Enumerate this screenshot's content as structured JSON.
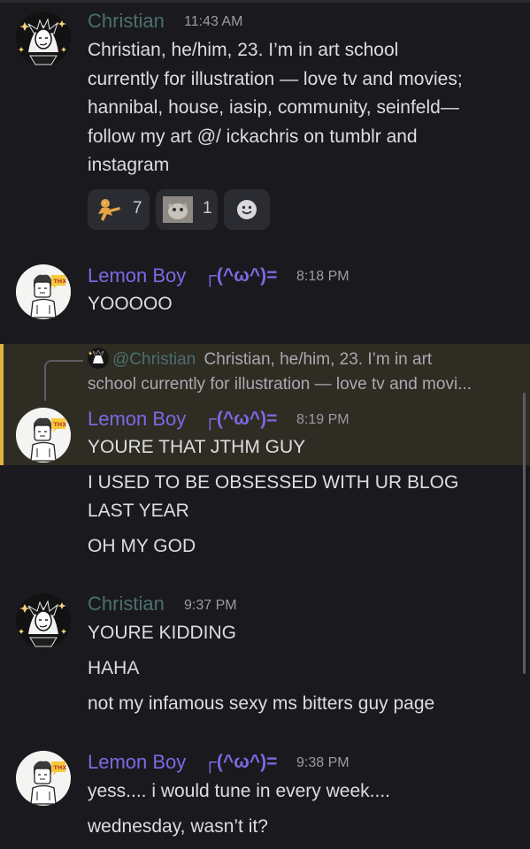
{
  "messages": [
    {
      "author": "Christian",
      "time": "11:43 AM",
      "lines": [
        "Christian, he/him, 23. I’m in art school",
        "currently for illustration — love tv and movies;",
        "hannibal, house, iasip, community, seinfeld—",
        "follow my art @/ ickachris on tumblr and",
        "instagram"
      ],
      "emoji": "🙂",
      "reactions": [
        {
          "icon": "gingerbread-dancer-emoji",
          "count": "7"
        },
        {
          "icon": "cat-face-photo-emoji",
          "count": "1"
        },
        {
          "icon": "add-reaction-icon",
          "count": ""
        }
      ]
    },
    {
      "author": "Lemon Boy",
      "tag": "┌(^ω^)=",
      "time": "8:18 PM",
      "lines": [
        "YOOOOO"
      ]
    },
    {
      "reply": {
        "mention": "@Christian",
        "preview_line1": "Christian, he/him, 23. I’m in art",
        "preview_line2": "school currently for illustration — love tv and movi..."
      },
      "author": "Lemon Boy",
      "tag": "┌(^ω^)=",
      "time": "8:19 PM",
      "lines": [
        "YOURE THAT JTHM GUY"
      ]
    },
    {
      "lines": [
        "I USED TO BE OBSESSED WITH UR BLOG",
        "LAST YEAR"
      ]
    },
    {
      "lines": [
        "OH MY GOD"
      ]
    },
    {
      "author": "Christian",
      "time": "9:37 PM",
      "lines": [
        "YOURE KIDDING"
      ]
    },
    {
      "lines": [
        "HAHA"
      ]
    },
    {
      "lines": [
        "not my infamous sexy ms bitters guy page"
      ]
    },
    {
      "author": "Lemon Boy",
      "tag": "┌(^ω^)=",
      "time": "9:38 PM",
      "lines": [
        "yess.... i would tune in every week...."
      ]
    },
    {
      "lines": [
        "wednesday, wasn’t it?"
      ]
    }
  ],
  "avatar_badge": "THX",
  "colors": {
    "background": "#1a1a1e",
    "christian_name": "#4b6f6d",
    "lemon_name": "#7b6ae3",
    "reply_highlight": "#2f2c24",
    "reply_accent": "#e3b341"
  }
}
